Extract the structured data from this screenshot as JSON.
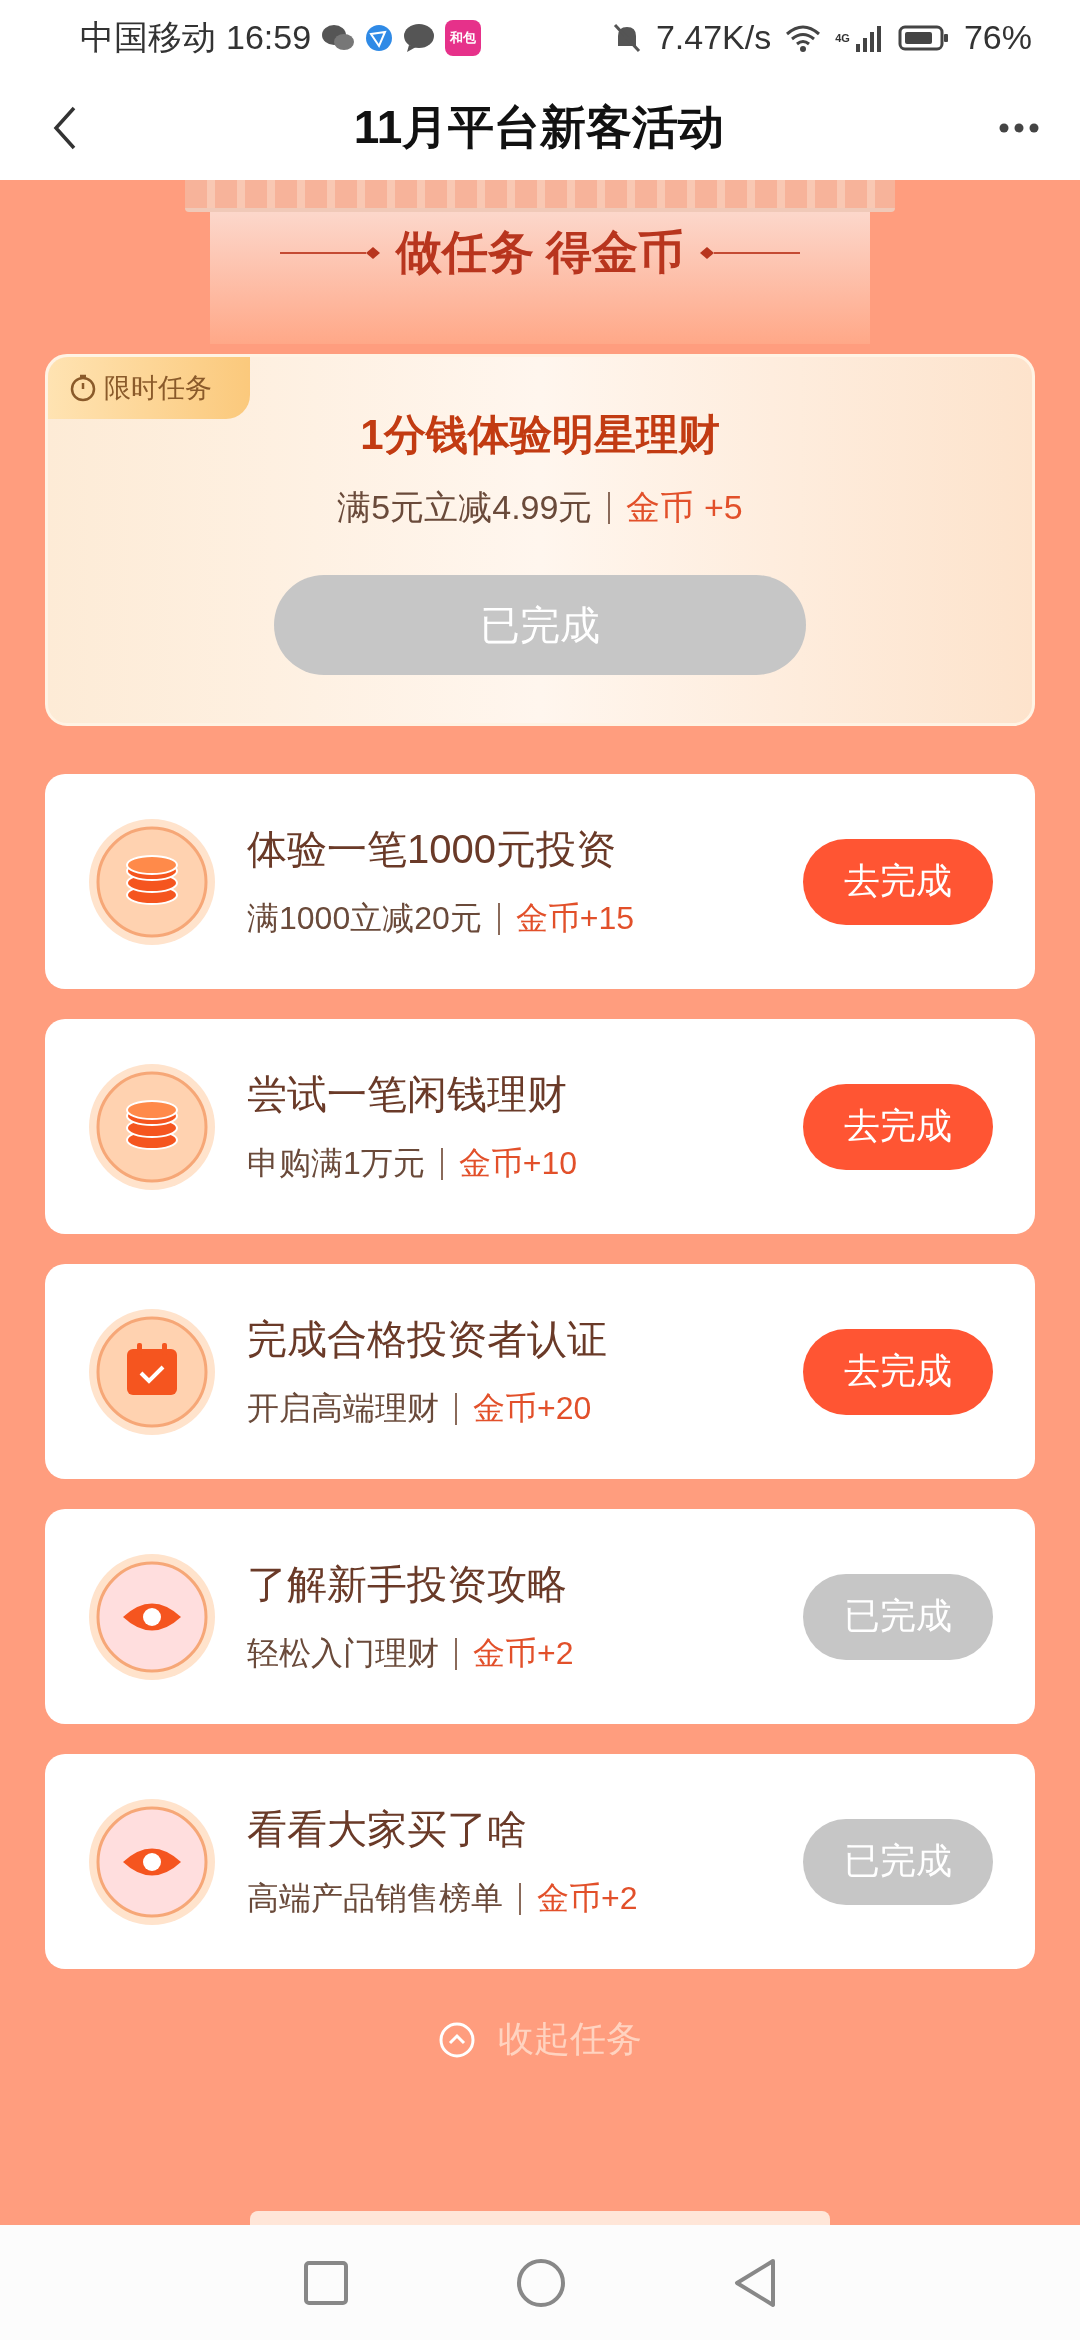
{
  "status_bar": {
    "carrier": "中国移动",
    "time": "16:59",
    "app_badge": "和包",
    "speed": "7.47K/s",
    "network": "4G",
    "battery": "76%"
  },
  "nav": {
    "title": "11月平台新客活动"
  },
  "banner": {
    "title": "做任务 得金币"
  },
  "featured": {
    "tag": "限时任务",
    "title": "1分钱体验明星理财",
    "condition": "满5元立减4.99元",
    "reward": "金币 +5",
    "button": "已完成",
    "completed": true
  },
  "tasks": [
    {
      "kind": "coins",
      "title": "体验一笔1000元投资",
      "condition": "满1000立减20元",
      "reward": "金币+15",
      "button": "去完成",
      "completed": false
    },
    {
      "kind": "coins",
      "title": "尝试一笔闲钱理财",
      "condition": "申购满1万元",
      "reward": "金币+10",
      "button": "去完成",
      "completed": false
    },
    {
      "kind": "calendar",
      "title": "完成合格投资者认证",
      "condition": "开启高端理财",
      "reward": "金币+20",
      "button": "去完成",
      "completed": false
    },
    {
      "kind": "eye",
      "title": "了解新手投资攻略",
      "condition": "轻松入门理财",
      "reward": "金币+2",
      "button": "已完成",
      "completed": true
    },
    {
      "kind": "eye",
      "title": "看看大家买了啥",
      "condition": "高端产品销售榜单",
      "reward": "金币+2",
      "button": "已完成",
      "completed": true
    }
  ],
  "collapse": {
    "label": "收起任务"
  }
}
